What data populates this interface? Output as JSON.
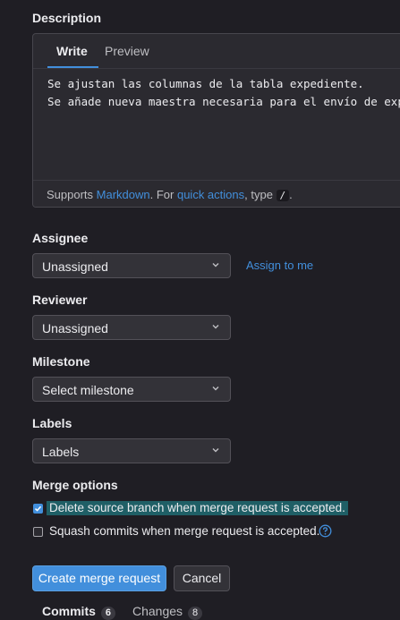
{
  "description": {
    "label": "Description",
    "tab_write": "Write",
    "tab_preview": "Preview",
    "body_line1": "Se ajustan las columnas de la tabla expediente.",
    "body_line2": "Se añade nueva maestra necesaria para el envío de expediente.",
    "footer_supports": "Supports ",
    "footer_markdown": "Markdown",
    "footer_for": ". For ",
    "footer_quick_actions": "quick actions",
    "footer_type": ", type ",
    "footer_slash": "/",
    "footer_end": "."
  },
  "assignee": {
    "label": "Assignee",
    "value": "Unassigned",
    "assign_to_me": "Assign to me"
  },
  "reviewer": {
    "label": "Reviewer",
    "value": "Unassigned"
  },
  "milestone": {
    "label": "Milestone",
    "value": "Select milestone"
  },
  "labels": {
    "label": "Labels",
    "value": "Labels"
  },
  "merge_options": {
    "label": "Merge options",
    "delete_branch": "Delete source branch when merge request is accepted.",
    "delete_branch_checked": true,
    "squash": "Squash commits when merge request is accepted.",
    "squash_checked": false,
    "help_icon": "question-circle-icon"
  },
  "buttons": {
    "create": "Create merge request",
    "cancel": "Cancel"
  },
  "bottom_tabs": {
    "commits_label": "Commits",
    "commits_count": "6",
    "changes_label": "Changes",
    "changes_count": "8"
  },
  "colors": {
    "accent": "#428fdc",
    "background": "#1f1e24",
    "highlight": "#1f5f66"
  }
}
